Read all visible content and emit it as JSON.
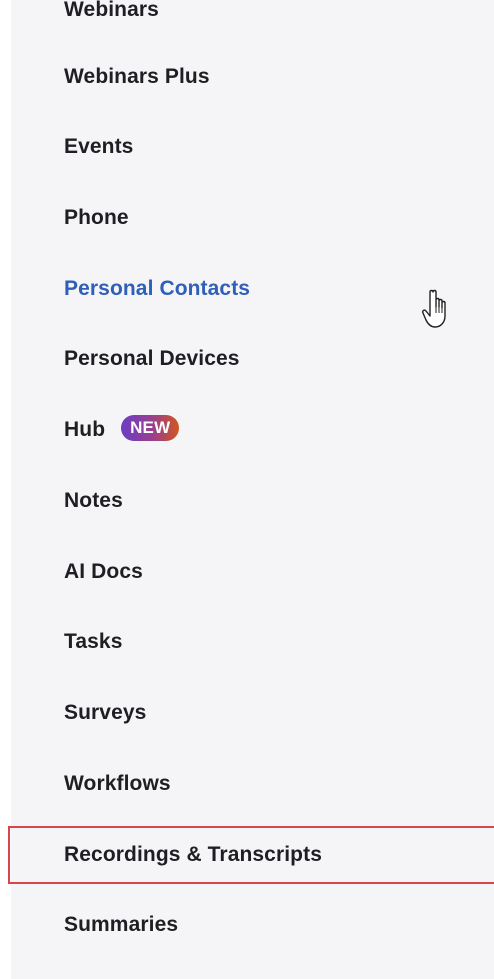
{
  "nav": {
    "items": [
      {
        "label": "Webinars",
        "state": "partially-visible"
      },
      {
        "label": "Webinars Plus"
      },
      {
        "label": "Events"
      },
      {
        "label": "Phone"
      },
      {
        "label": "Personal Contacts",
        "state": "active"
      },
      {
        "label": "Personal Devices"
      },
      {
        "label": "Hub",
        "badge": "NEW"
      },
      {
        "label": "Notes"
      },
      {
        "label": "AI Docs"
      },
      {
        "label": "Tasks"
      },
      {
        "label": "Surveys"
      },
      {
        "label": "Workflows"
      },
      {
        "label": "Recordings & Transcripts",
        "state": "highlighted"
      },
      {
        "label": "Summaries"
      }
    ]
  },
  "cursor": {
    "icon": "hand-pointer-icon"
  },
  "colors": {
    "panel_background": "#f5f5f8",
    "text": "#1f1f23",
    "active_text": "#2f5fb8",
    "highlight_border": "#d9464a",
    "badge_gradient_start": "#6b3ec4",
    "badge_gradient_end": "#d1561d"
  }
}
